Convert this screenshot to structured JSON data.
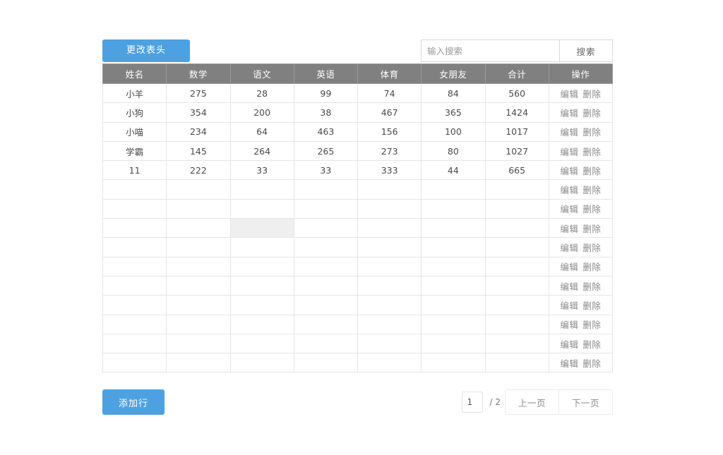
{
  "toolbar": {
    "change_header_label": "更改表头",
    "search_placeholder": "输入搜索",
    "search_value": "",
    "search_button_label": "搜索"
  },
  "table": {
    "columns": [
      "姓名",
      "数学",
      "语文",
      "英语",
      "体育",
      "女朋友",
      "合计",
      "操作"
    ],
    "row_actions": {
      "edit_label": "编辑",
      "delete_label": "删除"
    },
    "total_rows": 15,
    "hovered_cell": {
      "row_index": 7,
      "column_index": 2
    },
    "rows": [
      {
        "姓名": "小羊",
        "数学": "275",
        "语文": "28",
        "英语": "99",
        "体育": "74",
        "女朋友": "84",
        "合计": "560"
      },
      {
        "姓名": "小狗",
        "数学": "354",
        "语文": "200",
        "英语": "38",
        "体育": "467",
        "女朋友": "365",
        "合计": "1424"
      },
      {
        "姓名": "小喵",
        "数学": "234",
        "语文": "64",
        "英语": "463",
        "体育": "156",
        "女朋友": "100",
        "合计": "1017"
      },
      {
        "姓名": "学霸",
        "数学": "145",
        "语文": "264",
        "英语": "265",
        "体育": "273",
        "女朋友": "80",
        "合计": "1027"
      },
      {
        "姓名": "11",
        "数学": "222",
        "语文": "33",
        "英语": "33",
        "体育": "333",
        "女朋友": "44",
        "合计": "665"
      },
      {
        "姓名": "",
        "数学": "",
        "语文": "",
        "英语": "",
        "体育": "",
        "女朋友": "",
        "合计": ""
      },
      {
        "姓名": "",
        "数学": "",
        "语文": "",
        "英语": "",
        "体育": "",
        "女朋友": "",
        "合计": ""
      },
      {
        "姓名": "",
        "数学": "",
        "语文": "",
        "英语": "",
        "体育": "",
        "女朋友": "",
        "合计": ""
      },
      {
        "姓名": "",
        "数学": "",
        "语文": "",
        "英语": "",
        "体育": "",
        "女朋友": "",
        "合计": ""
      },
      {
        "姓名": "",
        "数学": "",
        "语文": "",
        "英语": "",
        "体育": "",
        "女朋友": "",
        "合计": ""
      },
      {
        "姓名": "",
        "数学": "",
        "语文": "",
        "英语": "",
        "体育": "",
        "女朋友": "",
        "合计": ""
      },
      {
        "姓名": "",
        "数学": "",
        "语文": "",
        "英语": "",
        "体育": "",
        "女朋友": "",
        "合计": ""
      },
      {
        "姓名": "",
        "数学": "",
        "语文": "",
        "英语": "",
        "体育": "",
        "女朋友": "",
        "合计": ""
      },
      {
        "姓名": "",
        "数学": "",
        "语文": "",
        "英语": "",
        "体育": "",
        "女朋友": "",
        "合计": ""
      },
      {
        "姓名": "",
        "数学": "",
        "语文": "",
        "英语": "",
        "体育": "",
        "女朋友": "",
        "合计": ""
      }
    ]
  },
  "footer": {
    "add_row_label": "添加行",
    "current_page": "1",
    "page_total_label": "/ 2",
    "prev_page_label": "上一页",
    "next_page_label": "下一页"
  },
  "colors": {
    "accent": "#4da1e0",
    "header_bg": "#808080",
    "grid_line": "#e6e6e6",
    "hover_cell": "#efefef",
    "text": "#4a4a4a",
    "muted": "#8a8a8a"
  }
}
